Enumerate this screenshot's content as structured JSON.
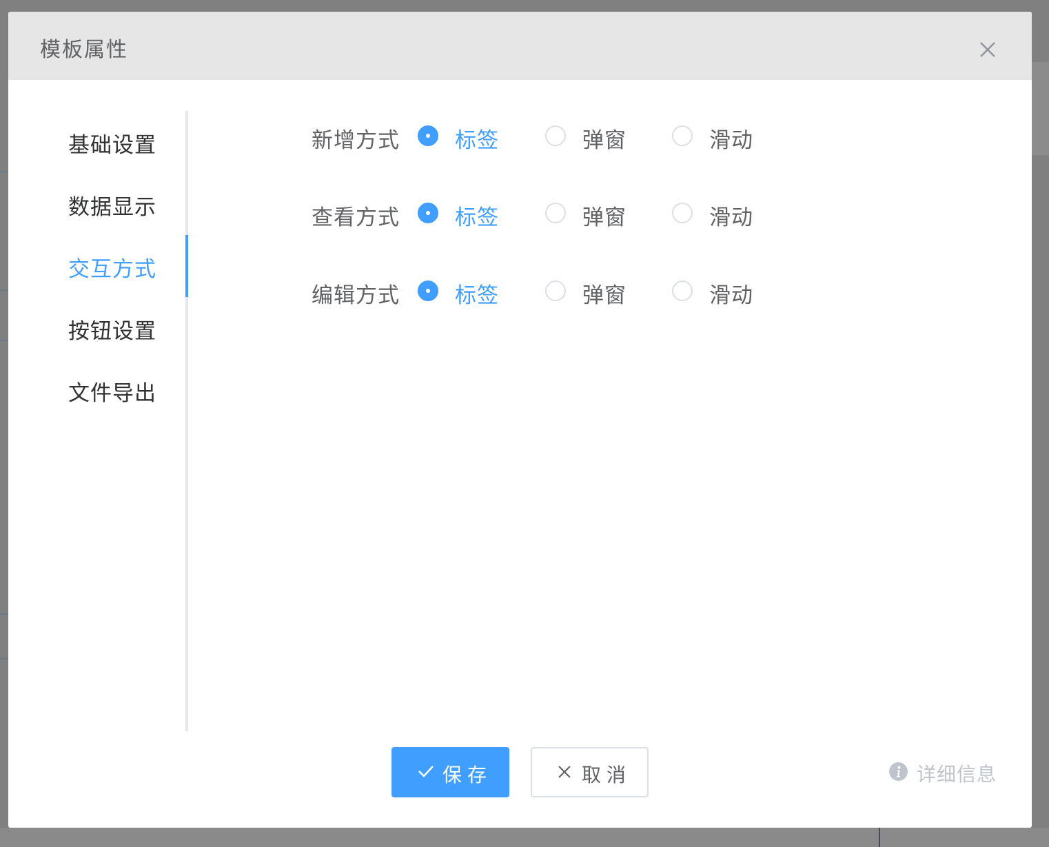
{
  "dialog": {
    "title": "模板属性"
  },
  "nav": {
    "items": [
      {
        "label": "基础设置",
        "active": false
      },
      {
        "label": "数据显示",
        "active": false
      },
      {
        "label": "交互方式",
        "active": true
      },
      {
        "label": "按钮设置",
        "active": false
      },
      {
        "label": "文件导出",
        "active": false
      }
    ]
  },
  "form": {
    "rows": [
      {
        "label": "新增方式",
        "options": [
          {
            "label": "标签",
            "checked": true
          },
          {
            "label": "弹窗",
            "checked": false
          },
          {
            "label": "滑动",
            "checked": false
          }
        ]
      },
      {
        "label": "查看方式",
        "options": [
          {
            "label": "标签",
            "checked": true
          },
          {
            "label": "弹窗",
            "checked": false
          },
          {
            "label": "滑动",
            "checked": false
          }
        ]
      },
      {
        "label": "编辑方式",
        "options": [
          {
            "label": "标签",
            "checked": true
          },
          {
            "label": "弹窗",
            "checked": false
          },
          {
            "label": "滑动",
            "checked": false
          }
        ]
      }
    ]
  },
  "footer": {
    "save_label": "保存",
    "cancel_label": "取消",
    "detail_label": "详细信息"
  },
  "colors": {
    "primary": "#409eff",
    "text": "#606266",
    "header_bg": "#e6e6e6",
    "muted": "#c0c4cc"
  },
  "icons": {
    "close": "close-icon",
    "check": "check-icon",
    "cancel": "x-icon",
    "info": "info-icon"
  }
}
